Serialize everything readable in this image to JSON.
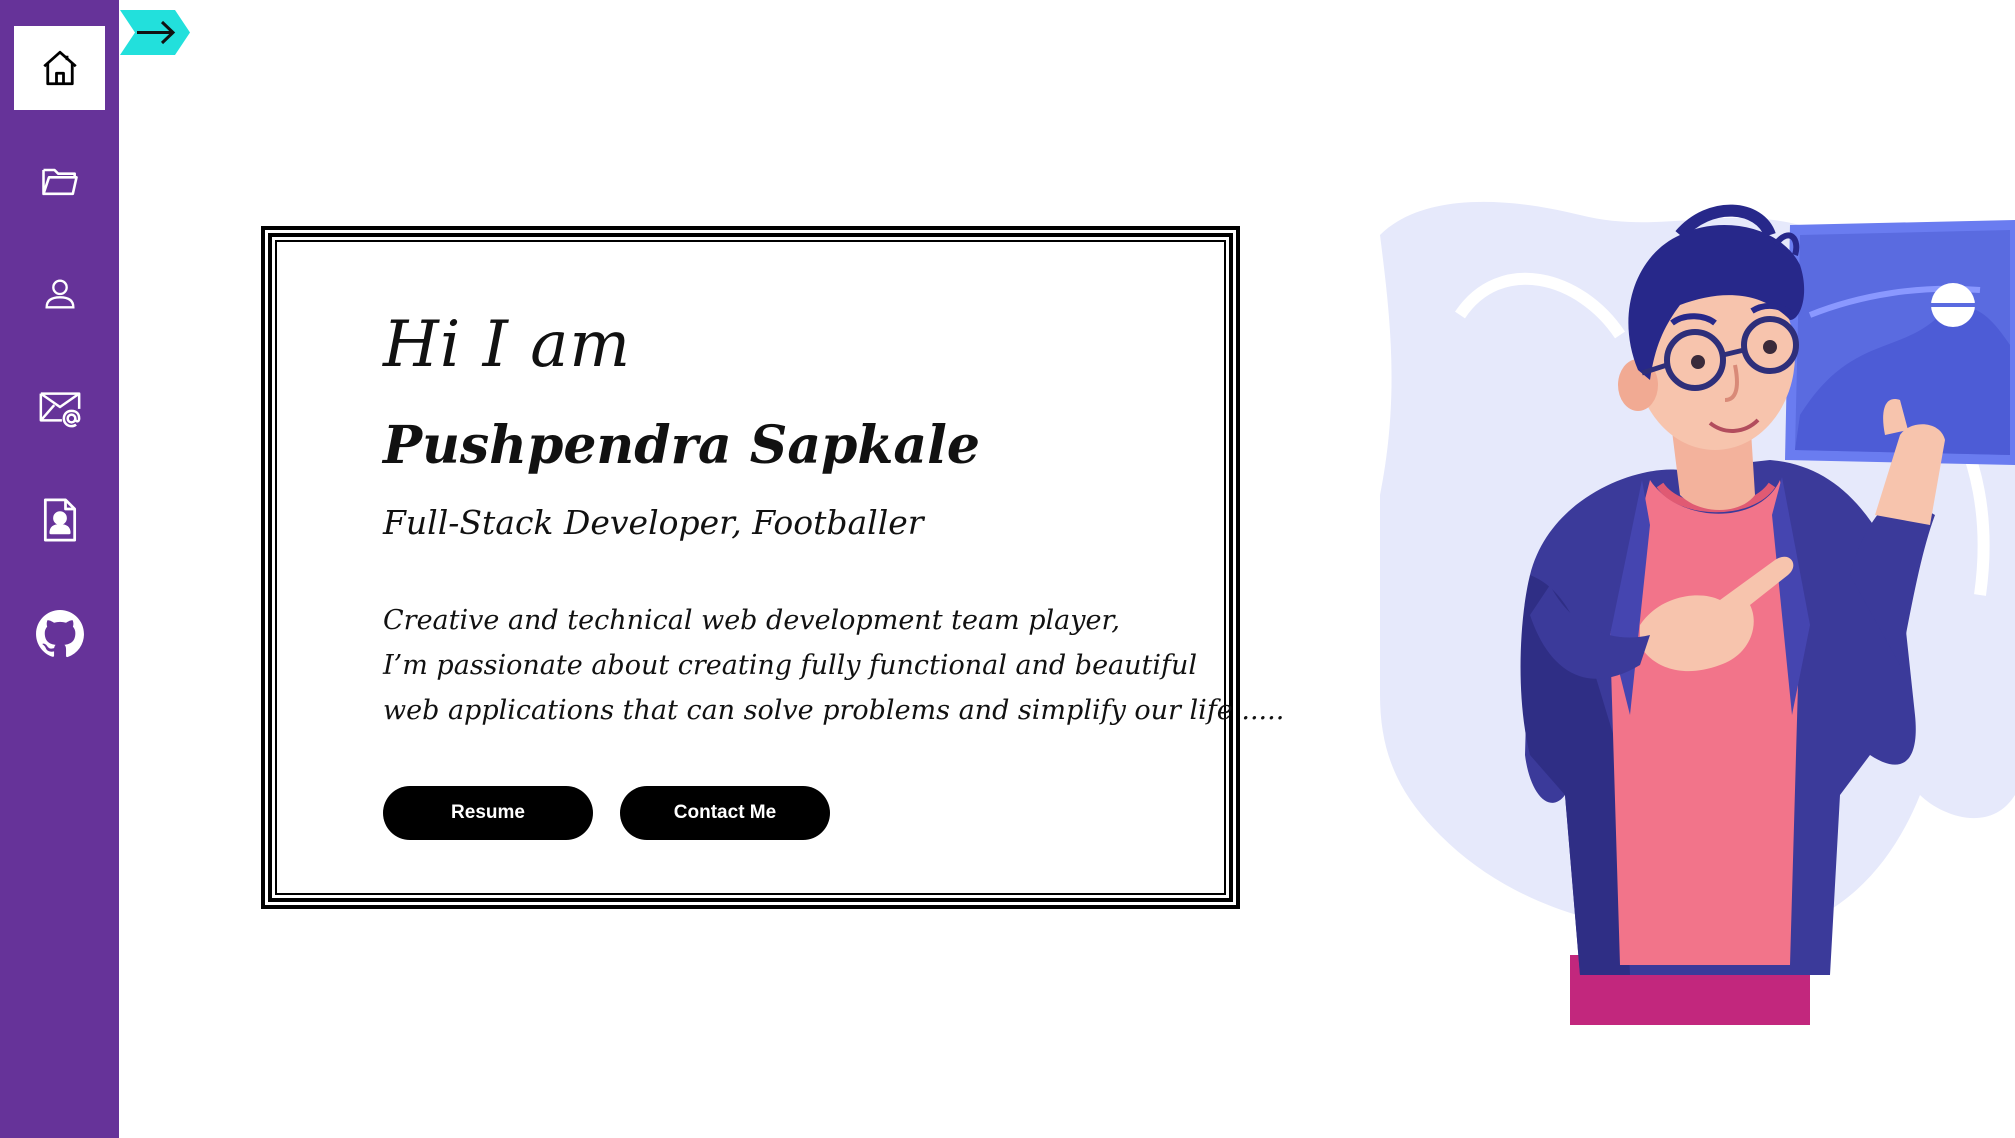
{
  "sidebar": {
    "items": [
      {
        "icon": "home-icon",
        "active": true
      },
      {
        "icon": "folder-icon",
        "active": false
      },
      {
        "icon": "user-icon",
        "active": false
      },
      {
        "icon": "mail-icon",
        "active": false
      },
      {
        "icon": "resume-file-icon",
        "active": false
      },
      {
        "icon": "github-icon",
        "active": false
      }
    ],
    "colors": {
      "background": "#663399",
      "active": "#ffffff",
      "icon": "#ffffff"
    }
  },
  "toggle": {
    "icon": "arrow-right-icon",
    "color": "#22e0dc"
  },
  "hero": {
    "greeting": "Hi I am",
    "name": "Pushpendra Sapkale",
    "role": "Full-Stack Developer, Footballer",
    "bio_lines": [
      "Creative and technical web development team player,",
      "I’m passionate about creating fully functional and beautiful",
      "web applications that can solve problems and simplify our life ....."
    ],
    "buttons": {
      "resume": "Resume",
      "contact": "Contact Me"
    }
  },
  "illustration": {
    "icon": "developer-illustration"
  }
}
